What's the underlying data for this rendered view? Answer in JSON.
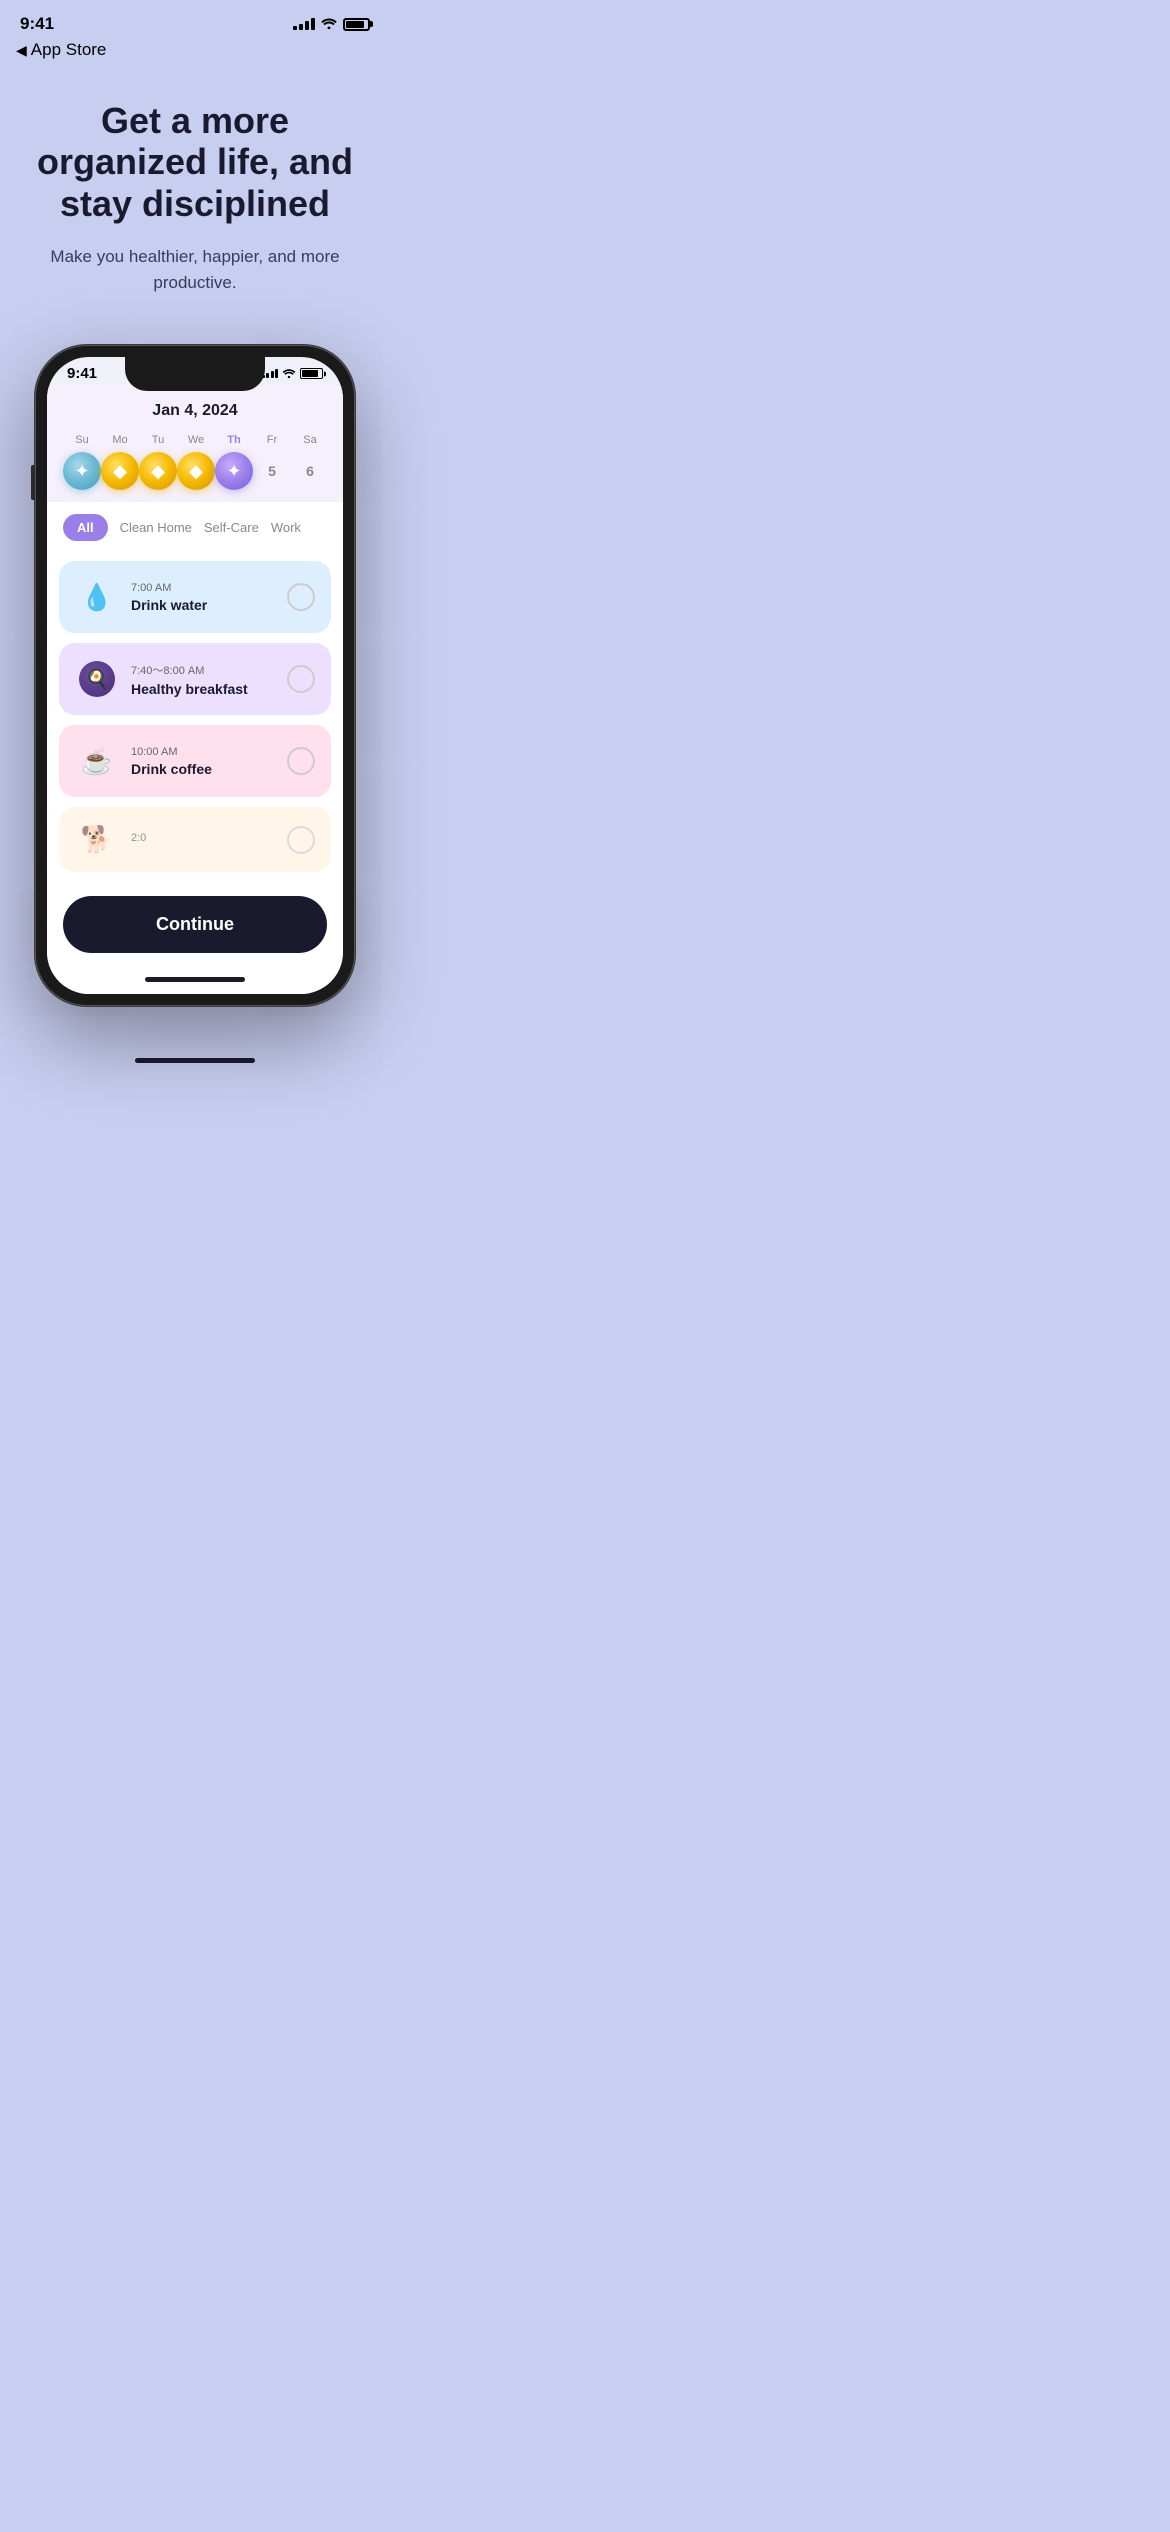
{
  "statusBar": {
    "time": "9:41",
    "appStoreBack": "App Store"
  },
  "hero": {
    "title": "Get a more organized life, and stay disciplined",
    "subtitle": "Make you healthier, happier, and more productive."
  },
  "phone": {
    "innerTime": "9:41",
    "calendar": {
      "dateLabel": "Jan 4, 2024",
      "days": [
        {
          "label": "Su",
          "type": "gem-blue",
          "value": ""
        },
        {
          "label": "Mo",
          "type": "gem-gold",
          "value": ""
        },
        {
          "label": "Tu",
          "type": "gem-gold",
          "value": ""
        },
        {
          "label": "We",
          "type": "gem-gold",
          "value": ""
        },
        {
          "label": "Th",
          "type": "gem-active",
          "value": ""
        },
        {
          "label": "Fr",
          "type": "number",
          "value": "5"
        },
        {
          "label": "Sa",
          "type": "number",
          "value": "6"
        }
      ]
    },
    "tabs": [
      {
        "label": "All",
        "active": true
      },
      {
        "label": "Clean Home",
        "active": false
      },
      {
        "label": "Self-Care",
        "active": false
      },
      {
        "label": "Work",
        "active": false
      }
    ],
    "habits": [
      {
        "time": "7:00 AM",
        "name": "Drink water",
        "icon": "💧",
        "color": "blue"
      },
      {
        "time": "7:40〜8:00 AM",
        "name": "Healthy breakfast",
        "icon": "🍳",
        "color": "purple"
      },
      {
        "time": "10:00 AM",
        "name": "Drink coffee",
        "icon": "☕",
        "color": "pink"
      },
      {
        "time": "2:0",
        "name": "",
        "icon": "🐕",
        "color": "cream"
      }
    ],
    "continueButton": "Continue"
  }
}
